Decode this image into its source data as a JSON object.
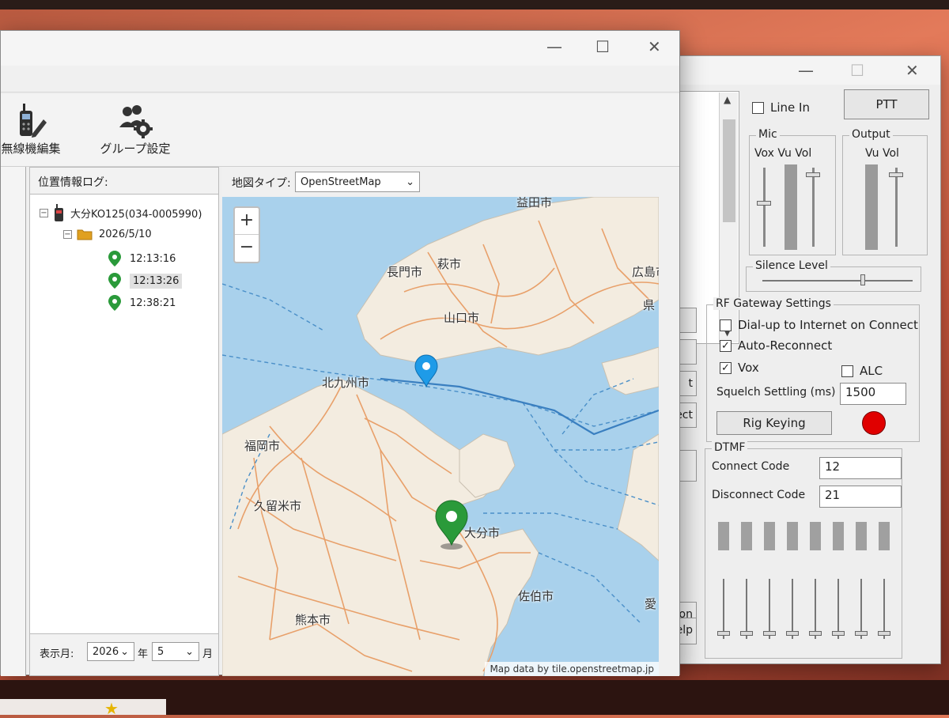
{
  "back_window": {
    "title_controls": {
      "minimize": "—",
      "maximize": "☐",
      "close": "✕"
    },
    "line_in": {
      "label": "Line In",
      "checked": false
    },
    "ptt_label": "PTT",
    "mic_group": {
      "title": "Mic",
      "columns": "Vox  Vu  Vol"
    },
    "output_group": {
      "title": "Output",
      "columns": "Vu  Vol"
    },
    "silence_level_label": "Silence Level",
    "rf_settings": {
      "title": "RF Gateway Settings",
      "dialup": {
        "label": "Dial-up to Internet on Connect",
        "checked": false
      },
      "auto_reconnect": {
        "label": "Auto-Reconnect",
        "checked": true
      },
      "vox": {
        "label": "Vox",
        "checked": true
      },
      "alc": {
        "label": "ALC",
        "checked": false
      },
      "squelch_label": "Squelch Settling (ms)",
      "squelch_value": "1500",
      "rig_keying_label": "Rig Keying",
      "led_color": "#e00000"
    },
    "dtmf": {
      "title": "DTMF",
      "connect_label": "Connect Code",
      "connect_value": "12",
      "disconnect_label": "Disconnect Code",
      "disconnect_value": "21"
    },
    "partial_buttons": [
      "t",
      "ect",
      "on",
      "elp"
    ]
  },
  "front_window": {
    "title_controls": {
      "minimize": "—",
      "maximize": "☐",
      "close": "✕"
    },
    "toolbar": {
      "radio_edit_label": "無線機編集",
      "group_settings_label": "グループ設定"
    },
    "log_panel": {
      "title": "位置情報ログ:",
      "root": "大分KO125(034-0005990)",
      "date": "2026/5/10",
      "entries": [
        "12:13:16",
        "12:13:26",
        "12:38:21"
      ],
      "month_label": "表示月:",
      "year_value": "2026",
      "year_unit": "年",
      "month_value": "5",
      "month_unit": "月"
    },
    "map_panel": {
      "type_label": "地図タイプ:",
      "type_value": "OpenStreetMap",
      "zoom_in": "+",
      "zoom_out": "−",
      "cities": [
        "益田市",
        "萩市",
        "長門市",
        "広島市",
        "山口市",
        "北九州市",
        "福岡市",
        "久留米市",
        "大分市",
        "佐伯市",
        "熊本市",
        "県",
        "愛"
      ],
      "attribution": "Map data by tile.openstreetmap.jp",
      "marker_colors": {
        "blue": "#1e9be8",
        "green": "#2a9a3a"
      }
    }
  }
}
